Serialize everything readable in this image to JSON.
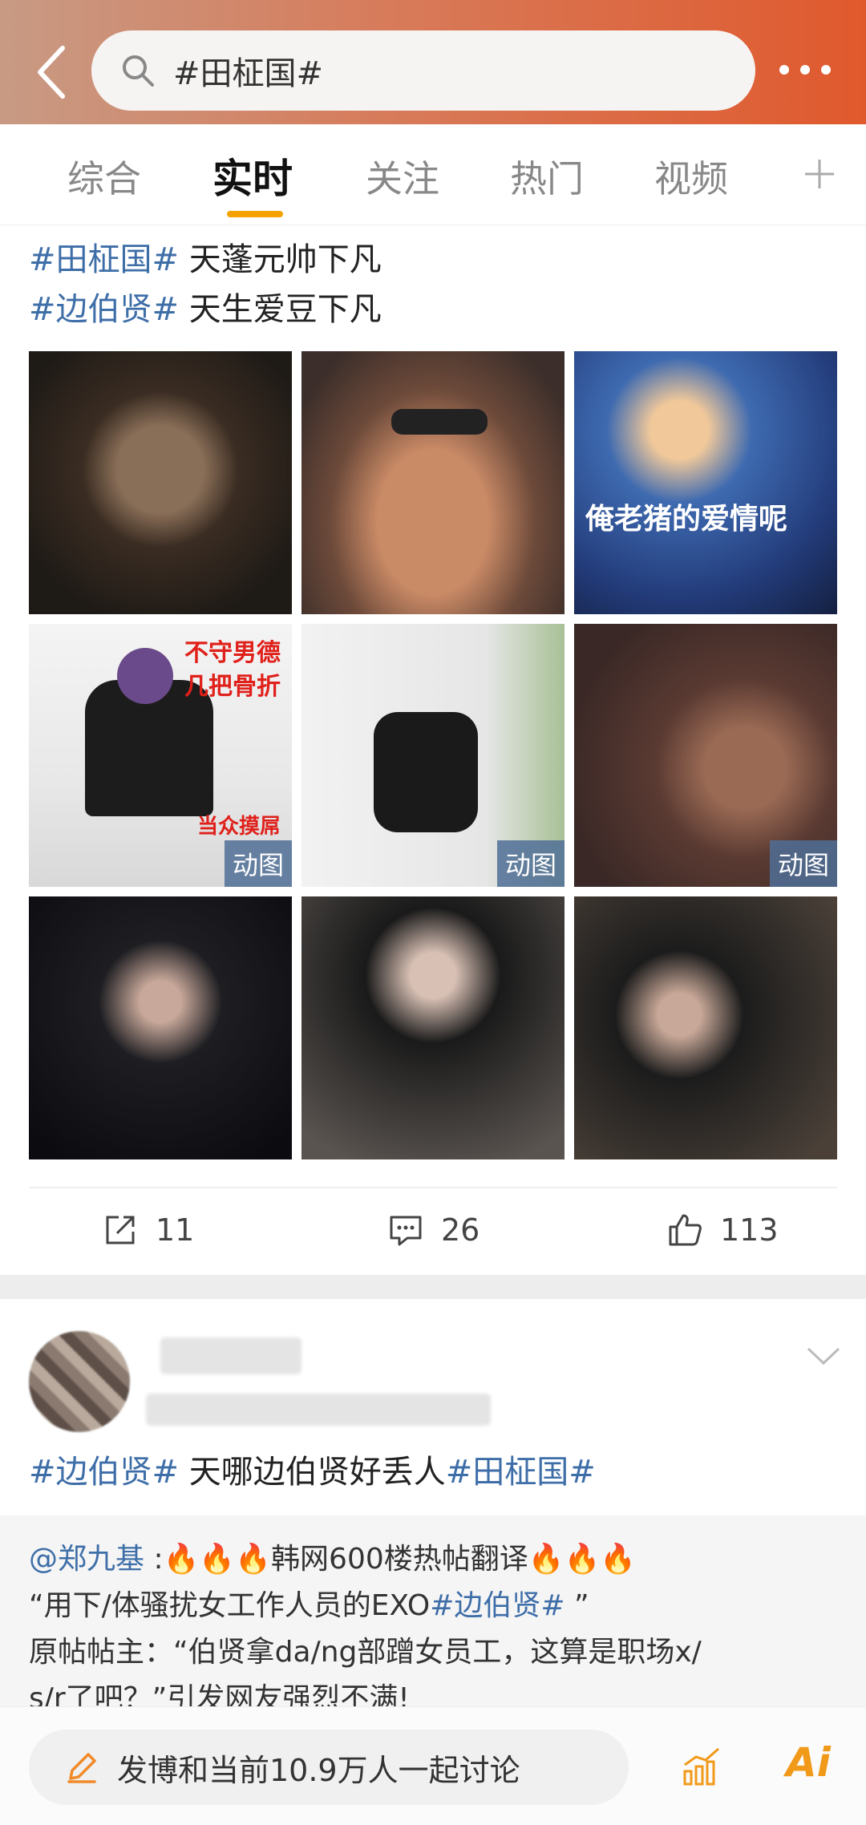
{
  "header": {
    "search_text": "#田柾国#"
  },
  "tabs": [
    {
      "label": "综合"
    },
    {
      "label": "实时"
    },
    {
      "label": "关注"
    },
    {
      "label": "热门"
    },
    {
      "label": "视频"
    }
  ],
  "post1": {
    "line1_tag": "#田柾国#",
    "line1_text": " 天蓬元帅下凡",
    "line2_tag": "#边伯贤#",
    "line2_text": " 天生爱豆下凡",
    "images": [
      {
        "badge": "",
        "caption": ""
      },
      {
        "badge": "",
        "caption": ""
      },
      {
        "badge": "",
        "caption": "俺老猪的爱情呢"
      },
      {
        "badge": "动图",
        "caption": "",
        "red_top": "不守男德\n几把骨折",
        "red_bottom": "当众摸屌"
      },
      {
        "badge": "动图",
        "caption": ""
      },
      {
        "badge": "动图",
        "caption": ""
      },
      {
        "badge": "",
        "caption": ""
      },
      {
        "badge": "",
        "caption": ""
      },
      {
        "badge": "",
        "caption": ""
      }
    ],
    "reposts": "11",
    "comments": "26",
    "likes": "113"
  },
  "post2": {
    "tag1": "#边伯贤#",
    "text": " 天哪边伯贤好丢人",
    "tag2": "#田柾国#",
    "repost_line1_user": "@郑九基",
    "repost_line1_text": " :🔥🔥🔥韩网600楼热帖翻译🔥🔥🔥",
    "repost_line2_pre": "“用下/体骚扰女工作人员的EXO",
    "repost_line2_tag": "#边伯贤#",
    "repost_line2_post": " ”",
    "repost_line3": "原帖帖主：“伯贤拿da/ng部蹭女员工，这算是职场x/",
    "repost_line4": "s/r了吧？”引发网友强烈不满!"
  },
  "bottom": {
    "compose_text": "发博和当前10.9万人一起讨论",
    "ai_label": "Ai"
  }
}
